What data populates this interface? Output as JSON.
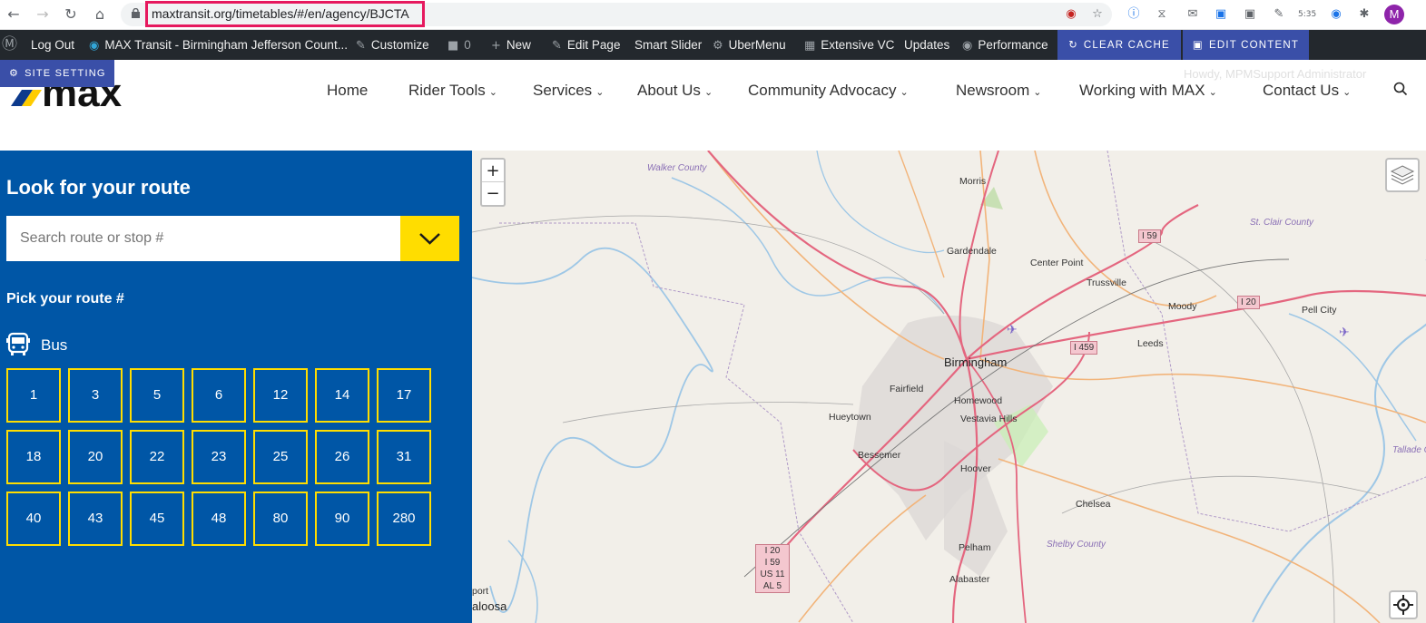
{
  "browser": {
    "url": "maxtransit.org/timetables/#/en/agency/BJCTA",
    "avatar_letter": "M",
    "clock": "5:35"
  },
  "adminbar": {
    "log_out": "Log Out",
    "site_name": "MAX Transit - Birmingham Jefferson Count...",
    "customize": "Customize",
    "comments": "0",
    "new": "New",
    "edit_page": "Edit Page",
    "smart_slider": "Smart Slider",
    "ubermenu": "UberMenu",
    "extensive_vc": "Extensive VC",
    "updates": "Updates",
    "performance": "Performance",
    "clear_cache": "CLEAR CACHE",
    "edit_content": "EDIT CONTENT",
    "howdy": "Howdy, MPMSupport Administrator"
  },
  "site_setting": "SITE SETTING",
  "nav": {
    "home": "Home",
    "rider_tools": "Rider Tools",
    "services": "Services",
    "about_us": "About Us",
    "community_advocacy": "Community Advocacy",
    "newsroom": "Newsroom",
    "working_with_max": "Working with MAX",
    "contact_us": "Contact Us"
  },
  "panel": {
    "title": "Look for your route",
    "search_placeholder": "Search route or stop #",
    "pick_label": "Pick your route #",
    "bus_label": "Bus",
    "routes": [
      "1",
      "3",
      "5",
      "6",
      "12",
      "14",
      "17",
      "18",
      "20",
      "22",
      "23",
      "25",
      "26",
      "31",
      "40",
      "43",
      "45",
      "48",
      "80",
      "90",
      "280"
    ]
  },
  "map": {
    "zoom_in": "+",
    "zoom_out": "−",
    "places": {
      "walker_county": "Walker County",
      "morris": "Morris",
      "gardendale": "Gardendale",
      "center_point": "Center Point",
      "trussville": "Trussville",
      "moody": "Moody",
      "pell_city": "Pell City",
      "st_clair_county": "St. Clair County",
      "birmingham": "Birmingham",
      "leeds": "Leeds",
      "fairfield": "Fairfield",
      "homewood": "Homewood",
      "hueytown": "Hueytown",
      "vestavia_hills": "Vestavia Hills",
      "bessemer": "Bessemer",
      "hoover": "Hoover",
      "chelsea": "Chelsea",
      "pelham": "Pelham",
      "shelby_county": "Shelby County",
      "alabaster": "Alabaster",
      "talladega_county": "Tallade Coun",
      "tuscaloosa": "aloosa",
      "airport": "port"
    },
    "shields": {
      "i59": "I 59",
      "i20": "I 20",
      "i459": "I 459",
      "multi": [
        "I 20",
        "I 59",
        "US 11",
        "AL 5"
      ]
    }
  }
}
